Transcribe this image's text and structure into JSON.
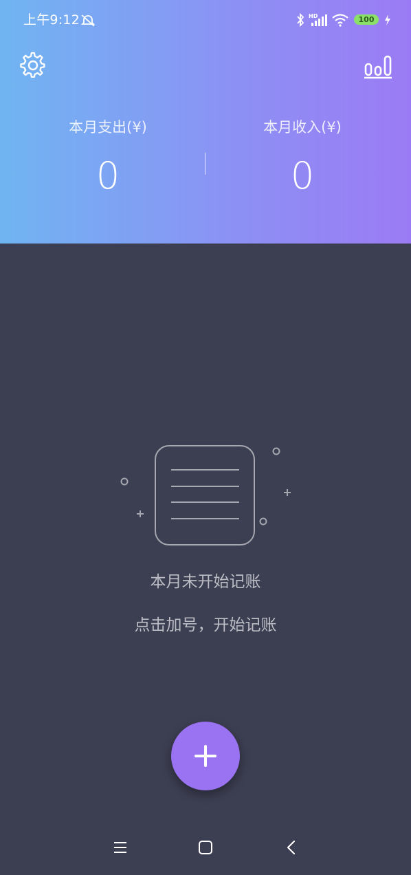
{
  "status_bar": {
    "time": "上午9:12",
    "battery": "100",
    "icons": [
      "alarm-off-icon",
      "bluetooth-icon",
      "hd-signal-icon",
      "wifi-icon",
      "battery-icon",
      "charging-icon"
    ]
  },
  "header": {
    "settings_icon": "gear-icon",
    "stats_icon": "bar-chart-icon",
    "expense_label": "本月支出(¥)",
    "expense_value": "0",
    "income_label": "本月收入(¥)",
    "income_value": "0"
  },
  "empty_state": {
    "icon": "document-lines-icon",
    "title": "本月未开始记账",
    "hint": "点击加号，开始记账"
  },
  "fab": {
    "icon": "plus-icon"
  },
  "nav_bar": {
    "icons": [
      "menu-icon",
      "home-icon",
      "back-icon"
    ]
  },
  "colors": {
    "header_gradient_start": "#70b5f2",
    "header_gradient_end": "#9b7bf5",
    "background": "#3c3e51",
    "fab": "#9a73f2",
    "text_muted": "#bdbdc6",
    "battery": "#8be06a"
  }
}
